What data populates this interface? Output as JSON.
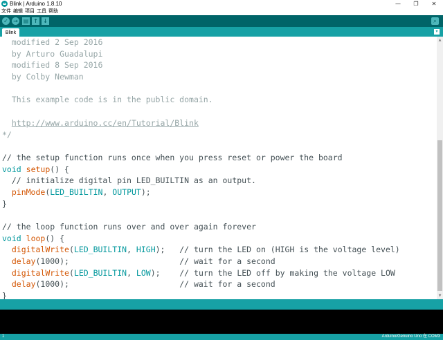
{
  "window": {
    "title": "Blink | Arduino 1.8.10",
    "minimize": "—",
    "maximize": "❐",
    "close": "✕"
  },
  "menu": [
    "文件",
    "编辑",
    "项目",
    "工具",
    "帮助"
  ],
  "toolbar": {
    "verify_icon": "✓",
    "upload_icon": "→",
    "new_icon": "▤",
    "open_icon": "↑",
    "save_icon": "↓",
    "serial_icon": "⌕"
  },
  "tabs": [
    {
      "label": "Blink"
    }
  ],
  "tab_menu_icon": "▾",
  "code_lines": [
    [
      {
        "t": "  modified 2 Sep 2016",
        "c": "comment"
      }
    ],
    [
      {
        "t": "  by Arturo Guadalupi",
        "c": "comment"
      }
    ],
    [
      {
        "t": "  modified 8 Sep 2016",
        "c": "comment"
      }
    ],
    [
      {
        "t": "  by Colby Newman",
        "c": "comment"
      }
    ],
    [
      {
        "t": "",
        "c": "text"
      }
    ],
    [
      {
        "t": "  This example code is in the public domain.",
        "c": "comment"
      }
    ],
    [
      {
        "t": "",
        "c": "text"
      }
    ],
    [
      {
        "t": "  ",
        "c": "comment"
      },
      {
        "t": "http://www.arduino.cc/en/Tutorial/Blink",
        "c": "url"
      }
    ],
    [
      {
        "t": "*/",
        "c": "comment"
      }
    ],
    [
      {
        "t": "",
        "c": "text"
      }
    ],
    [
      {
        "t": "// the setup function runs once when you press reset or power the board",
        "c": "text"
      }
    ],
    [
      {
        "t": "void",
        "c": "kw"
      },
      {
        "t": " ",
        "c": "text"
      },
      {
        "t": "setup",
        "c": "fn"
      },
      {
        "t": "() {",
        "c": "text"
      }
    ],
    [
      {
        "t": "  // initialize digital pin LED_BUILTIN as an output.",
        "c": "text"
      }
    ],
    [
      {
        "t": "  ",
        "c": "text"
      },
      {
        "t": "pinMode",
        "c": "fn"
      },
      {
        "t": "(",
        "c": "text"
      },
      {
        "t": "LED_BUILTIN",
        "c": "const"
      },
      {
        "t": ", ",
        "c": "text"
      },
      {
        "t": "OUTPUT",
        "c": "const"
      },
      {
        "t": ");",
        "c": "text"
      }
    ],
    [
      {
        "t": "}",
        "c": "text"
      }
    ],
    [
      {
        "t": "",
        "c": "text"
      }
    ],
    [
      {
        "t": "// the loop function runs over and over again forever",
        "c": "text"
      }
    ],
    [
      {
        "t": "void",
        "c": "kw"
      },
      {
        "t": " ",
        "c": "text"
      },
      {
        "t": "loop",
        "c": "fn"
      },
      {
        "t": "() {",
        "c": "text"
      }
    ],
    [
      {
        "t": "  ",
        "c": "text"
      },
      {
        "t": "digitalWrite",
        "c": "fn"
      },
      {
        "t": "(",
        "c": "text"
      },
      {
        "t": "LED_BUILTIN",
        "c": "const"
      },
      {
        "t": ", ",
        "c": "text"
      },
      {
        "t": "HIGH",
        "c": "const"
      },
      {
        "t": ");   // turn the LED on (HIGH is the voltage level)",
        "c": "text"
      }
    ],
    [
      {
        "t": "  ",
        "c": "text"
      },
      {
        "t": "delay",
        "c": "fn"
      },
      {
        "t": "(1000);                       // wait for a second",
        "c": "text"
      }
    ],
    [
      {
        "t": "  ",
        "c": "text"
      },
      {
        "t": "digitalWrite",
        "c": "fn"
      },
      {
        "t": "(",
        "c": "text"
      },
      {
        "t": "LED_BUILTIN",
        "c": "const"
      },
      {
        "t": ", ",
        "c": "text"
      },
      {
        "t": "LOW",
        "c": "const"
      },
      {
        "t": ");    // turn the LED off by making the voltage LOW",
        "c": "text"
      }
    ],
    [
      {
        "t": "  ",
        "c": "text"
      },
      {
        "t": "delay",
        "c": "fn"
      },
      {
        "t": "(1000);                       // wait for a second",
        "c": "text"
      }
    ],
    [
      {
        "t": "}",
        "c": "text"
      }
    ]
  ],
  "status": {
    "line_number": "1",
    "board": "Arduino/Genuino Uno 在 COM3"
  },
  "colors": {
    "toolbar": "#006468",
    "tabbar": "#17a1a5",
    "keyword": "#00979c",
    "function": "#d35400",
    "comment": "#95a5a6",
    "text": "#434f54"
  }
}
